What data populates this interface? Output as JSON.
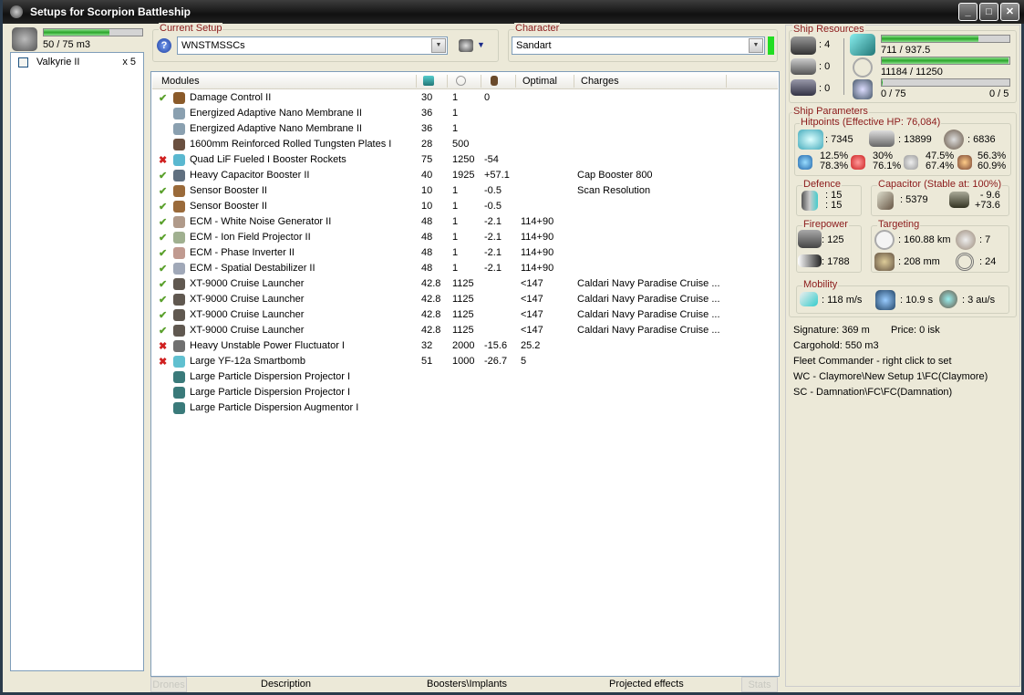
{
  "window": {
    "title": "Setups for Scorpion Battleship"
  },
  "drones": {
    "capacity": "50 / 75 m3",
    "capacity_fraction": 0.667,
    "items": [
      {
        "name": "Valkyrie II",
        "qty": "x 5"
      }
    ]
  },
  "current_setup": {
    "label": "Current Setup",
    "value": "WNSTMSSCs"
  },
  "character": {
    "label": "Character",
    "value": "Sandart"
  },
  "modules": {
    "headers": [
      "Modules",
      "",
      "",
      "",
      "Optimal",
      "Charges"
    ],
    "rows": [
      {
        "status": "ok",
        "name": "Damage Control II",
        "c1": "30",
        "c2": "1",
        "c3": "0",
        "opt": "",
        "charge": "",
        "icon": "#8a5a2a"
      },
      {
        "status": "",
        "name": "Energized Adaptive Nano Membrane II",
        "c1": "36",
        "c2": "1",
        "c3": "",
        "opt": "",
        "charge": "",
        "icon": "#8aa0b0"
      },
      {
        "status": "",
        "name": "Energized Adaptive Nano Membrane II",
        "c1": "36",
        "c2": "1",
        "c3": "",
        "opt": "",
        "charge": "",
        "icon": "#8aa0b0"
      },
      {
        "status": "",
        "name": "1600mm Reinforced Rolled Tungsten Plates I",
        "c1": "28",
        "c2": "500",
        "c3": "",
        "opt": "",
        "charge": "",
        "icon": "#6a5040"
      },
      {
        "status": "bad",
        "name": "Quad LiF Fueled I Booster Rockets",
        "c1": "75",
        "c2": "1250",
        "c3": "-54",
        "opt": "",
        "charge": "",
        "icon": "#5ab8d0"
      },
      {
        "status": "ok",
        "name": "Heavy Capacitor Booster II",
        "c1": "40",
        "c2": "1925",
        "c3": "+57.1",
        "opt": "",
        "charge": "Cap Booster 800",
        "icon": "#607080"
      },
      {
        "status": "ok",
        "name": "Sensor Booster II",
        "c1": "10",
        "c2": "1",
        "c3": "-0.5",
        "opt": "",
        "charge": "Scan Resolution",
        "icon": "#9a6a3a"
      },
      {
        "status": "ok",
        "name": "Sensor Booster II",
        "c1": "10",
        "c2": "1",
        "c3": "-0.5",
        "opt": "",
        "charge": "",
        "icon": "#9a6a3a"
      },
      {
        "status": "ok",
        "name": "ECM - White Noise Generator II",
        "c1": "48",
        "c2": "1",
        "c3": "-2.1",
        "opt": "114+90",
        "charge": "",
        "icon": "#b09a8a"
      },
      {
        "status": "ok",
        "name": "ECM - Ion Field Projector II",
        "c1": "48",
        "c2": "1",
        "c3": "-2.1",
        "opt": "114+90",
        "charge": "",
        "icon": "#a0b090"
      },
      {
        "status": "ok",
        "name": "ECM - Phase Inverter II",
        "c1": "48",
        "c2": "1",
        "c3": "-2.1",
        "opt": "114+90",
        "charge": "",
        "icon": "#c09a90"
      },
      {
        "status": "ok",
        "name": "ECM - Spatial Destabilizer II",
        "c1": "48",
        "c2": "1",
        "c3": "-2.1",
        "opt": "114+90",
        "charge": "",
        "icon": "#a0a8b8"
      },
      {
        "status": "ok",
        "name": "XT-9000 Cruise Launcher",
        "c1": "42.8",
        "c2": "1125",
        "c3": "",
        "opt": "<147",
        "charge": "Caldari Navy Paradise Cruise ...",
        "icon": "#605850"
      },
      {
        "status": "ok",
        "name": "XT-9000 Cruise Launcher",
        "c1": "42.8",
        "c2": "1125",
        "c3": "",
        "opt": "<147",
        "charge": "Caldari Navy Paradise Cruise ...",
        "icon": "#605850"
      },
      {
        "status": "ok",
        "name": "XT-9000 Cruise Launcher",
        "c1": "42.8",
        "c2": "1125",
        "c3": "",
        "opt": "<147",
        "charge": "Caldari Navy Paradise Cruise ...",
        "icon": "#605850"
      },
      {
        "status": "ok",
        "name": "XT-9000 Cruise Launcher",
        "c1": "42.8",
        "c2": "1125",
        "c3": "",
        "opt": "<147",
        "charge": "Caldari Navy Paradise Cruise ...",
        "icon": "#605850"
      },
      {
        "status": "bad",
        "name": "Heavy Unstable Power Fluctuator I",
        "c1": "32",
        "c2": "2000",
        "c3": "-15.6",
        "opt": "25.2",
        "charge": "",
        "icon": "#707070"
      },
      {
        "status": "bad",
        "name": "Large YF-12a Smartbomb",
        "c1": "51",
        "c2": "1000",
        "c3": "-26.7",
        "opt": "5",
        "charge": "",
        "icon": "#60c0d0"
      },
      {
        "status": "",
        "name": "Large Particle Dispersion Projector I",
        "c1": "",
        "c2": "",
        "c3": "",
        "opt": "",
        "charge": "",
        "icon": "#3a7a7a"
      },
      {
        "status": "",
        "name": "Large Particle Dispersion Projector I",
        "c1": "",
        "c2": "",
        "c3": "",
        "opt": "",
        "charge": "",
        "icon": "#3a7a7a"
      },
      {
        "status": "",
        "name": "Large Particle Dispersion Augmentor I",
        "c1": "",
        "c2": "",
        "c3": "",
        "opt": "",
        "charge": "",
        "icon": "#3a7a7a"
      }
    ]
  },
  "status_marks": {
    "ok": "✔",
    "bad": "✖"
  },
  "bottom_tabs": [
    "Drones",
    "Description",
    "Boosters\\Implants",
    "Projected effects",
    "Stats"
  ],
  "resources": {
    "label": "Ship Resources",
    "turrets": ": 4",
    "launchers": ": 0",
    "rigs": ": 0",
    "cpu": "711 / 937.5",
    "cpu_fraction": 0.758,
    "power": "11184 / 11250",
    "power_fraction": 0.994,
    "drone_bay": "0 / 75",
    "drone_bay_fraction": 0.0,
    "drone_count": "0 / 5"
  },
  "parameters": {
    "label": "Ship Parameters",
    "hp_label": "Hitpoints (Effective HP: 76,084)",
    "shield": ": 7345",
    "armor": ": 13899",
    "hull": ": 6836",
    "resists": [
      [
        "12.5%",
        "78.3%"
      ],
      [
        "30%",
        "76.1%"
      ],
      [
        "47.5%",
        "67.4%"
      ],
      [
        "56.3%",
        "60.9%"
      ]
    ],
    "defence_label": "Defence",
    "def1": ": 15",
    "def2": ": 15",
    "cap_label": "Capacitor (Stable at: 100%)",
    "cap": ": 5379",
    "cap_use": "- 9.6",
    "cap_gain": "+73.6",
    "fire_label": "Firepower",
    "dps": ": 125",
    "volley": ": 1788",
    "targ_label": "Targeting",
    "range": ": 160.88 km",
    "max_targets": ": 7",
    "scan_res": ": 208 mm",
    "sensor": ": 24",
    "mob_label": "Mobility",
    "speed": ": 118 m/s",
    "align": ": 10.9 s",
    "warp": ": 3 au/s"
  },
  "info": [
    "Signature: 369 m",
    "Price: 0 isk",
    "Cargohold: 550 m3",
    "Fleet Commander - right click to set",
    "WC - Claymore\\New Setup 1\\FC(Claymore)",
    "SC - Damnation\\FC\\FC(Damnation)"
  ]
}
